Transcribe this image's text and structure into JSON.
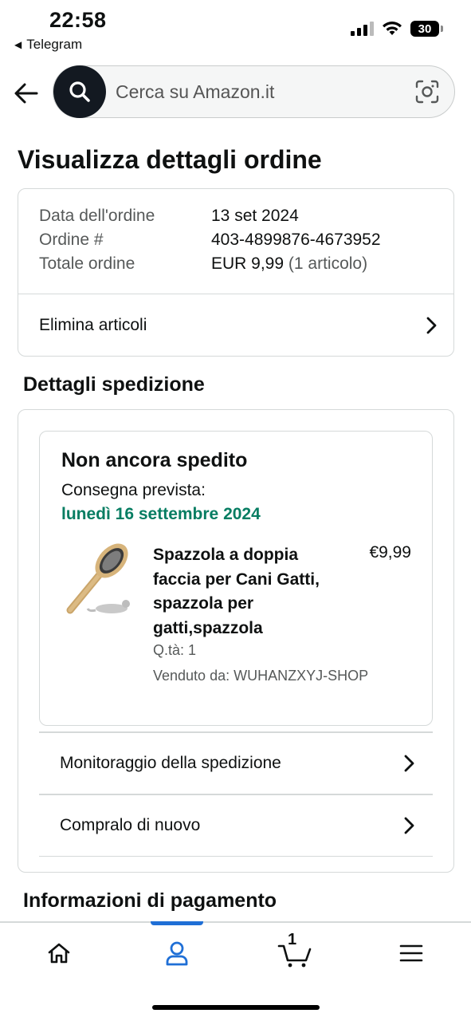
{
  "status_bar": {
    "time": "22:58",
    "back_app": "Telegram",
    "battery": "30"
  },
  "search": {
    "placeholder": "Cerca su Amazon.it",
    "icons": [
      "back-arrow-icon",
      "search-icon",
      "camera-icon"
    ]
  },
  "page_title": "Visualizza dettagli ordine",
  "order": {
    "date_label": "Data dell'ordine",
    "date_value": "13 set 2024",
    "number_label": "Ordine #",
    "number_value": "403-4899876-4673952",
    "total_label": "Totale ordine",
    "total_value": "EUR 9,99",
    "total_items": "(1 articolo)",
    "delete_items": "Elimina articoli"
  },
  "shipping": {
    "title": "Dettagli spedizione",
    "status": "Non ancora spedito",
    "delivery_label": "Consegna prevista:",
    "delivery_date": "lunedì 16 settembre 2024",
    "product": {
      "title": "Spazzola a doppia faccia per Cani Gatti, spazzola per gatti,spazzola",
      "price": "€9,99",
      "qty": "Q.tà: 1",
      "seller": "Venduto da: WUHANZXYJ-SHOP"
    },
    "track_label": "Monitoraggio della spedizione",
    "buy_again_label": "Compralo di nuovo"
  },
  "payment": {
    "title": "Informazioni di pagamento"
  },
  "bottom_nav": {
    "cart_count": "1",
    "items": [
      "home-icon",
      "account-icon",
      "cart-icon",
      "menu-icon"
    ],
    "active_color": "#1f6fd6"
  },
  "colors": {
    "delivery_green": "#067d62",
    "search_button": "#131921"
  }
}
